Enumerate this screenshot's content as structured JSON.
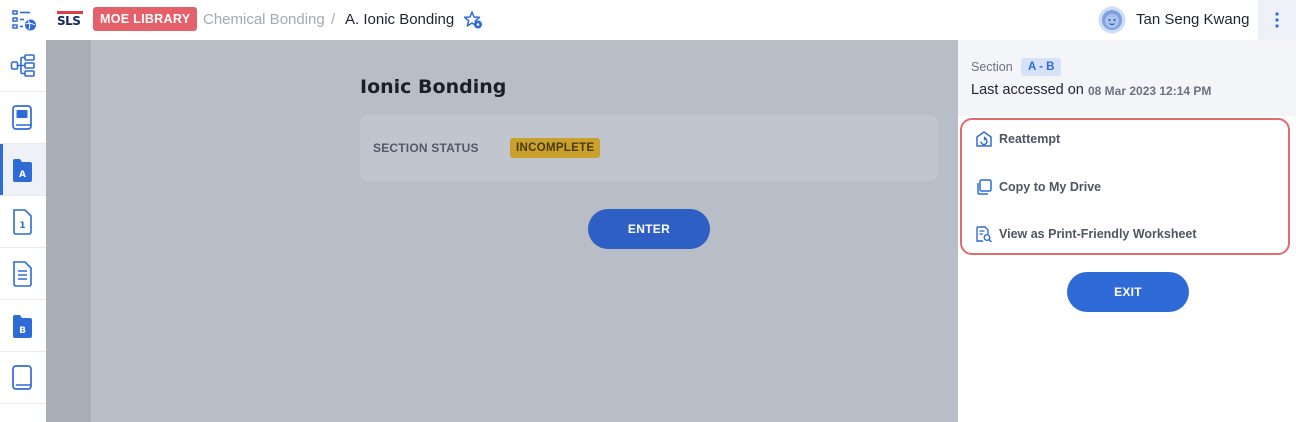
{
  "header": {
    "logo_text": "SLS",
    "library_badge": "MOE LIBRARY",
    "breadcrumb": [
      {
        "label": "Chemical Bonding"
      },
      {
        "label": "A. Ionic Bonding"
      }
    ],
    "breadcrumb_separator": "/",
    "user_name": "Tan Seng Kwang"
  },
  "sidebar": {
    "items": [
      {
        "icon": "lesson-map-icon"
      },
      {
        "icon": "book-icon"
      },
      {
        "icon": "section-a-icon",
        "label": "A",
        "active": true
      },
      {
        "icon": "section-1-icon",
        "label": "1"
      },
      {
        "icon": "document-icon"
      },
      {
        "icon": "section-b-icon",
        "label": "B"
      },
      {
        "icon": "book-end-icon"
      }
    ]
  },
  "main": {
    "title": "Ionic Bonding",
    "status_label": "SECTION STATUS",
    "status_value": "INCOMPLETE",
    "enter_label": "ENTER"
  },
  "panel": {
    "section_label": "Section",
    "section_value": "A - B",
    "last_accessed_label": "Last accessed on",
    "last_accessed_date": "08 Mar 2023 12:14 PM",
    "actions": [
      {
        "label": "Reattempt",
        "icon": "reattempt-icon"
      },
      {
        "label": "Copy to My Drive",
        "icon": "copy-icon"
      },
      {
        "label": "View as Print-Friendly Worksheet",
        "icon": "worksheet-search-icon"
      }
    ],
    "exit_label": "EXIT"
  },
  "colors": {
    "accent": "#2f6bd6",
    "badge_red": "#e5616a",
    "status_gold": "#c9a12c",
    "highlight_border": "#e06c70"
  }
}
